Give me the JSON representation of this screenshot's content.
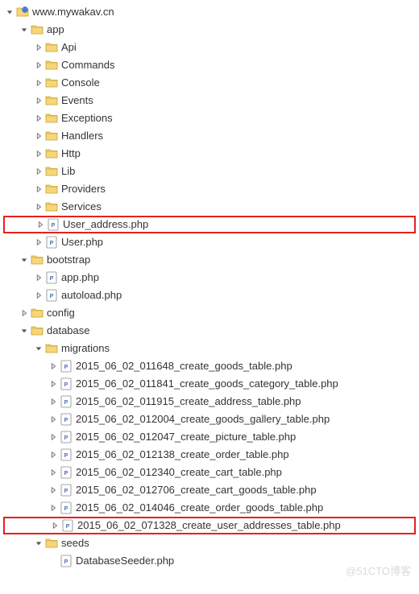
{
  "root": {
    "label": "www.mywakav.cn",
    "expanded": true,
    "icon": "web-folder",
    "highlighted": false,
    "children": [
      {
        "label": "app",
        "expanded": true,
        "icon": "folder",
        "highlighted": false,
        "children": [
          {
            "label": "Api",
            "expanded": false,
            "icon": "folder",
            "highlighted": false,
            "children": []
          },
          {
            "label": "Commands",
            "expanded": false,
            "icon": "folder",
            "highlighted": false,
            "children": []
          },
          {
            "label": "Console",
            "expanded": false,
            "icon": "folder",
            "highlighted": false,
            "children": []
          },
          {
            "label": "Events",
            "expanded": false,
            "icon": "folder",
            "highlighted": false,
            "children": []
          },
          {
            "label": "Exceptions",
            "expanded": false,
            "icon": "folder",
            "highlighted": false,
            "children": []
          },
          {
            "label": "Handlers",
            "expanded": false,
            "icon": "folder",
            "highlighted": false,
            "children": []
          },
          {
            "label": "Http",
            "expanded": false,
            "icon": "folder",
            "highlighted": false,
            "children": []
          },
          {
            "label": "Lib",
            "expanded": false,
            "icon": "folder",
            "highlighted": false,
            "children": []
          },
          {
            "label": "Providers",
            "expanded": false,
            "icon": "folder",
            "highlighted": false,
            "children": []
          },
          {
            "label": "Services",
            "expanded": false,
            "icon": "folder",
            "highlighted": false,
            "children": []
          },
          {
            "label": "User_address.php",
            "expanded": false,
            "icon": "php",
            "highlighted": true,
            "children": []
          },
          {
            "label": "User.php",
            "expanded": false,
            "icon": "php",
            "highlighted": false,
            "children": []
          }
        ]
      },
      {
        "label": "bootstrap",
        "expanded": true,
        "icon": "folder",
        "highlighted": false,
        "children": [
          {
            "label": "app.php",
            "expanded": false,
            "icon": "php",
            "highlighted": false,
            "children": []
          },
          {
            "label": "autoload.php",
            "expanded": false,
            "icon": "php",
            "highlighted": false,
            "children": []
          }
        ]
      },
      {
        "label": "config",
        "expanded": false,
        "icon": "folder",
        "highlighted": false,
        "children": []
      },
      {
        "label": "database",
        "expanded": true,
        "icon": "folder",
        "highlighted": false,
        "children": [
          {
            "label": "migrations",
            "expanded": true,
            "icon": "folder",
            "highlighted": false,
            "children": [
              {
                "label": "2015_06_02_011648_create_goods_table.php",
                "expanded": false,
                "icon": "php",
                "highlighted": false,
                "children": []
              },
              {
                "label": "2015_06_02_011841_create_goods_category_table.php",
                "expanded": false,
                "icon": "php",
                "highlighted": false,
                "children": []
              },
              {
                "label": "2015_06_02_011915_create_address_table.php",
                "expanded": false,
                "icon": "php",
                "highlighted": false,
                "children": []
              },
              {
                "label": "2015_06_02_012004_create_goods_gallery_table.php",
                "expanded": false,
                "icon": "php",
                "highlighted": false,
                "children": []
              },
              {
                "label": "2015_06_02_012047_create_picture_table.php",
                "expanded": false,
                "icon": "php",
                "highlighted": false,
                "children": []
              },
              {
                "label": "2015_06_02_012138_create_order_table.php",
                "expanded": false,
                "icon": "php",
                "highlighted": false,
                "children": []
              },
              {
                "label": "2015_06_02_012340_create_cart_table.php",
                "expanded": false,
                "icon": "php",
                "highlighted": false,
                "children": []
              },
              {
                "label": "2015_06_02_012706_create_cart_goods_table.php",
                "expanded": false,
                "icon": "php",
                "highlighted": false,
                "children": []
              },
              {
                "label": "2015_06_02_014046_create_order_goods_table.php",
                "expanded": false,
                "icon": "php",
                "highlighted": false,
                "children": []
              },
              {
                "label": "2015_06_02_071328_create_user_addresses_table.php",
                "expanded": false,
                "icon": "php",
                "highlighted": true,
                "children": []
              }
            ]
          },
          {
            "label": "seeds",
            "expanded": true,
            "icon": "folder",
            "highlighted": false,
            "children": [
              {
                "label": "DatabaseSeeder.php",
                "expanded": null,
                "icon": "php",
                "highlighted": false,
                "children": []
              }
            ]
          }
        ]
      }
    ]
  },
  "watermark": "@51CTO博客"
}
